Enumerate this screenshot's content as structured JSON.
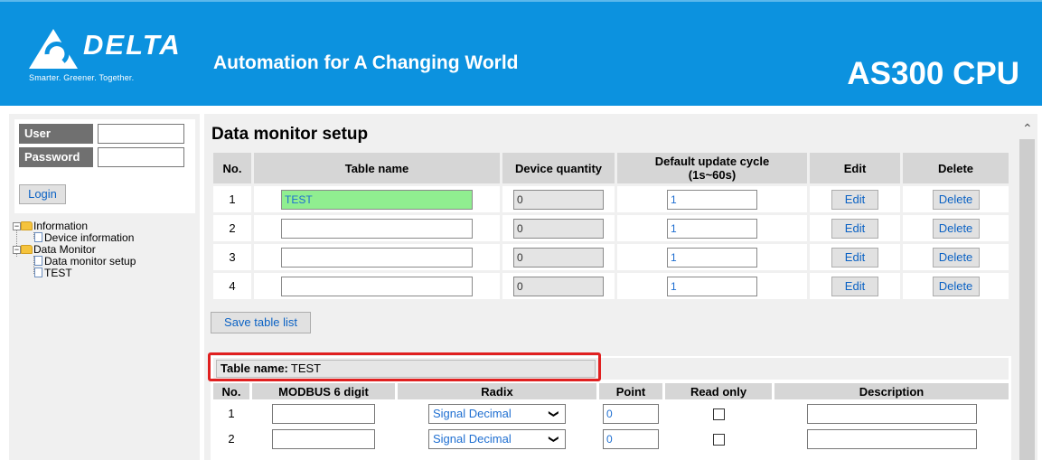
{
  "header": {
    "brand": "DELTA",
    "tagline": "Smarter. Greener. Together.",
    "slogan": "Automation for A Changing World",
    "product": "AS300 CPU"
  },
  "login": {
    "user_label": "User",
    "password_label": "Password",
    "user_value": "",
    "password_value": "",
    "login_button": "Login"
  },
  "tree": {
    "information": "Information",
    "device_information": "Device information",
    "data_monitor": "Data Monitor",
    "data_monitor_setup": "Data monitor setup",
    "test": "TEST",
    "expander": "−"
  },
  "page": {
    "title": "Data monitor setup",
    "save_button": "Save table list"
  },
  "table_list": {
    "headers": {
      "no": "No.",
      "table_name": "Table name",
      "device_quantity": "Device quantity",
      "cycle_line1": "Default update cycle",
      "cycle_line2": "(1s~60s)",
      "edit": "Edit",
      "delete": "Delete"
    },
    "rows": [
      {
        "no": "1",
        "name": "TEST",
        "qty": "0",
        "cycle": "1",
        "edit": "Edit",
        "delete": "Delete"
      },
      {
        "no": "2",
        "name": "",
        "qty": "0",
        "cycle": "1",
        "edit": "Edit",
        "delete": "Delete"
      },
      {
        "no": "3",
        "name": "",
        "qty": "0",
        "cycle": "1",
        "edit": "Edit",
        "delete": "Delete"
      },
      {
        "no": "4",
        "name": "",
        "qty": "0",
        "cycle": "1",
        "edit": "Edit",
        "delete": "Delete"
      }
    ]
  },
  "device_table": {
    "name_label": "Table name:",
    "name_value": "TEST",
    "headers": {
      "no": "No.",
      "modbus": "MODBUS 6 digit",
      "radix": "Radix",
      "point": "Point",
      "read_only": "Read only",
      "description": "Description"
    },
    "rows": [
      {
        "no": "1",
        "modbus": "",
        "radix": "Signal Decimal",
        "point": "0",
        "description": ""
      },
      {
        "no": "2",
        "modbus": "",
        "radix": "Signal Decimal",
        "point": "0",
        "description": ""
      }
    ]
  },
  "colors": {
    "header_bg": "#0c92df",
    "highlight": "#e02020",
    "active_input": "#90ee90"
  }
}
